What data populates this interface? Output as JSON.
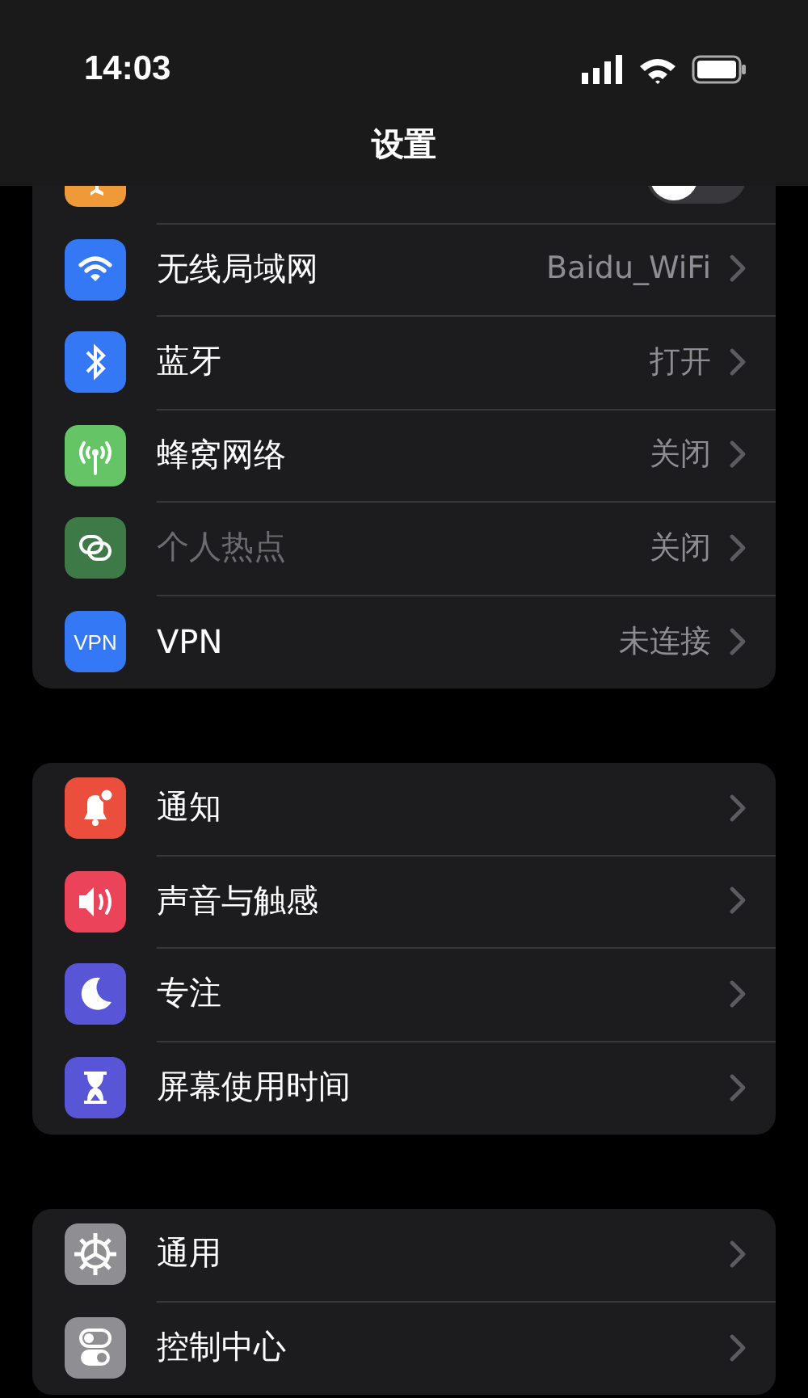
{
  "status_bar": {
    "time": "14:03"
  },
  "nav": {
    "title": "设置"
  },
  "groups": [
    {
      "rows": [
        {
          "color": "#f09a37",
          "kind": "toggle",
          "on": false
        },
        {
          "color": "#3478f6",
          "kind": "link",
          "label": "无线局域网",
          "value": "Baidu_WiFi",
          "disabled": false
        },
        {
          "color": "#3478f6",
          "kind": "link",
          "label": "蓝牙",
          "value": "打开",
          "disabled": false
        },
        {
          "color": "#65c466",
          "kind": "link",
          "label": "蜂窝网络",
          "value": "关闭",
          "disabled": false
        },
        {
          "color": "#3d7a48",
          "kind": "link",
          "label": "个人热点",
          "value": "关闭",
          "disabled": true
        },
        {
          "color": "#3478f6",
          "kind": "link",
          "label": "VPN",
          "value": "未连接",
          "icon_text": "VPN",
          "disabled": false
        }
      ]
    },
    {
      "rows": [
        {
          "color": "#eb4e3d",
          "kind": "link",
          "label": "通知"
        },
        {
          "color": "#eb445a",
          "kind": "link",
          "label": "声音与触感"
        },
        {
          "color": "#5856d6",
          "kind": "link",
          "label": "专注"
        },
        {
          "color": "#5856d6",
          "kind": "link",
          "label": "屏幕使用时间"
        }
      ]
    },
    {
      "rows": [
        {
          "color": "#8e8e93",
          "kind": "link",
          "label": "通用"
        },
        {
          "color": "#8e8e93",
          "kind": "link",
          "label": "控制中心"
        }
      ]
    }
  ]
}
